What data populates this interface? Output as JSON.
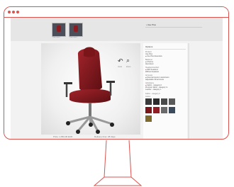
{
  "window": {
    "dots_color": "#d9534f"
  },
  "thumbnails": [
    {
      "caption": "Chair view 1"
    },
    {
      "caption": "Chair view 2"
    }
  ],
  "product": {
    "name": "• Use Plus"
  },
  "viewer": {
    "undo_icon": "undo-icon",
    "zoom_icon": "zoom-icon",
    "undo_label": "Undo",
    "zoom_label": "Zoom"
  },
  "footer": {
    "price_label": "Price: 1,652,00 EUR",
    "delivery_label": "Delivery time: 28 days"
  },
  "options": {
    "title": "Options",
    "sections": [
      {
        "heading": "Product",
        "items": [
          {
            "label": "Use Plus",
            "selected": false
          },
          {
            "label": "Use Plus Executive",
            "selected": true
          }
        ]
      },
      {
        "heading": "Backrest",
        "items": [
          {
            "label": "Chrome",
            "selected": true
          },
          {
            "label": "Aluminium",
            "selected": false
          }
        ]
      },
      {
        "heading": "Headrest/comfort",
        "items": [
          {
            "label": "With headrest",
            "selected": true
          },
          {
            "label": "Without headrest",
            "selected": false
          }
        ]
      },
      {
        "heading": "Armrests",
        "items": [
          {
            "label": "Fixed armrests in aluminium",
            "selected": true
          },
          {
            "label": "Adjustable 3D armrests",
            "selected": false
          }
        ]
      },
      {
        "heading": "Upholstery",
        "items": [
          {
            "label": "Fabric - category F",
            "selected": true
          },
          {
            "label": "Premium fabric - category G",
            "selected": false
          },
          {
            "label": "Leather - category L",
            "selected": false
          }
        ]
      }
    ],
    "colors_heading": "Fabric - category F",
    "colors_sub": "Colour",
    "swatches": [
      "#3a3a3a",
      "#2b2b2b",
      "#4a4a4a",
      "#5a5a5a",
      "#7a1519",
      "#8f1e24",
      "#6a6a6a",
      "#3d4a5c",
      "#7f6a2e"
    ]
  }
}
